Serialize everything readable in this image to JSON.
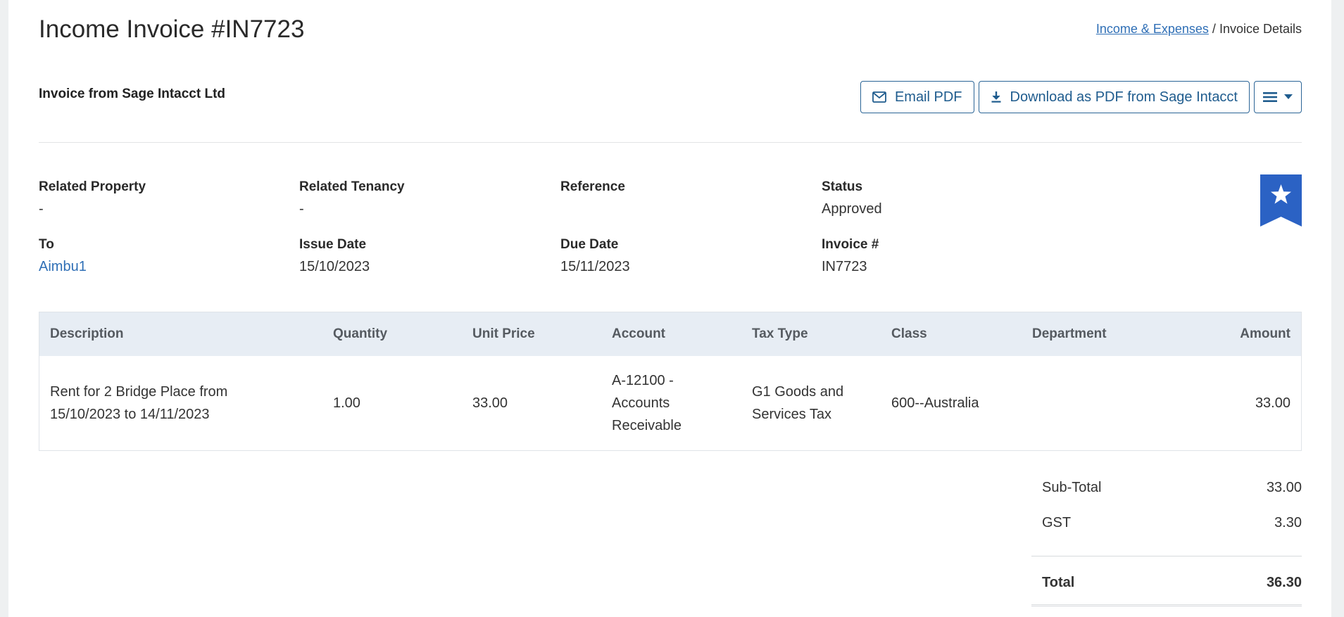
{
  "header": {
    "title": "Income Invoice #IN7723",
    "breadcrumb_link": "Income & Expenses",
    "breadcrumb_sep": " / ",
    "breadcrumb_current": "Invoice Details"
  },
  "invoice_from": "Invoice from Sage Intacct Ltd",
  "actions": {
    "email_pdf": "Email PDF",
    "download_pdf": "Download as PDF from Sage Intacct"
  },
  "details": {
    "related_property": {
      "label": "Related Property",
      "value": "-"
    },
    "related_tenancy": {
      "label": "Related Tenancy",
      "value": "-"
    },
    "reference": {
      "label": "Reference",
      "value": ""
    },
    "status": {
      "label": "Status",
      "value": "Approved"
    },
    "to": {
      "label": "To",
      "value": "Aimbu1"
    },
    "issue_date": {
      "label": "Issue Date",
      "value": "15/10/2023"
    },
    "due_date": {
      "label": "Due Date",
      "value": "15/11/2023"
    },
    "invoice_no": {
      "label": "Invoice #",
      "value": "IN7723"
    }
  },
  "table": {
    "headers": {
      "description": "Description",
      "quantity": "Quantity",
      "unit_price": "Unit Price",
      "account": "Account",
      "tax_type": "Tax Type",
      "class": "Class",
      "department": "Department",
      "amount": "Amount"
    },
    "rows": [
      {
        "description_line1": "Rent for 2 Bridge Place from",
        "description_line2": "15/10/2023 to 14/11/2023",
        "quantity": "1.00",
        "unit_price": "33.00",
        "account_line1": "A-12100 -",
        "account_line2": "Accounts",
        "account_line3": "Receivable",
        "tax_type_line1": "G1 Goods and",
        "tax_type_line2": "Services Tax",
        "class": "600--Australia",
        "department": "",
        "amount": "33.00"
      }
    ]
  },
  "totals": {
    "subtotal_label": "Sub-Total",
    "subtotal_value": "33.00",
    "gst_label": "GST",
    "gst_value": "3.30",
    "total_label": "Total",
    "total_value": "36.30"
  },
  "colors": {
    "accent": "#2f6fb6",
    "button_text": "#1f5c8e",
    "ribbon": "#2b62c4",
    "table_header_bg": "#e7edf4"
  },
  "icons": {
    "email": "envelope-icon",
    "download": "download-icon",
    "menu": "hamburger-icon",
    "menu_caret": "caret-down-icon",
    "bookmark": "star-ribbon-icon"
  }
}
